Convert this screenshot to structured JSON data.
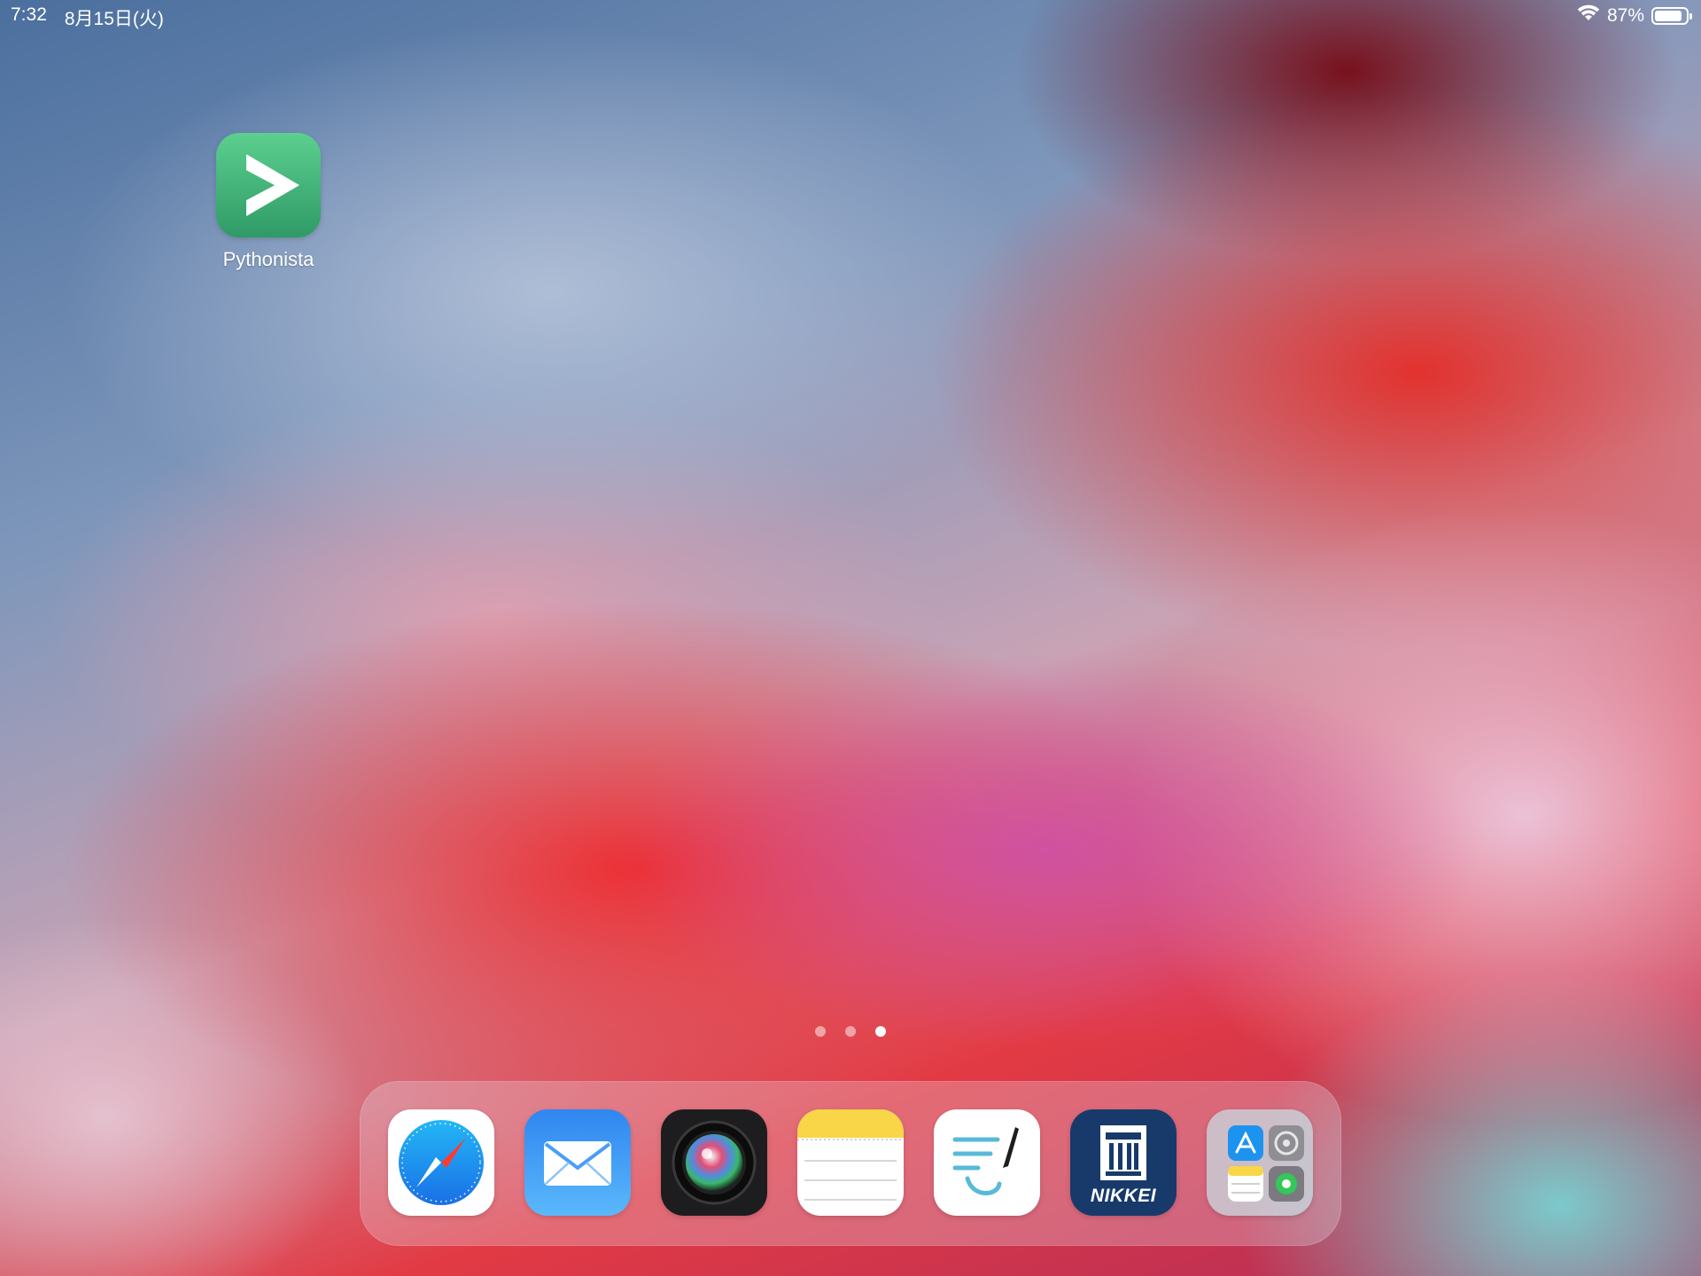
{
  "status_bar": {
    "time": "7:32",
    "date": "8月15日(火)",
    "battery_percent": "87%",
    "battery_level": 0.87,
    "icons": [
      "wifi-icon",
      "battery-icon"
    ]
  },
  "home_screen": {
    "apps": [
      {
        "label": "Pythonista",
        "icon": "pythonista-icon"
      }
    ],
    "page_dots": {
      "count": 3,
      "active_index": 2
    }
  },
  "dock": {
    "apps": [
      {
        "icon": "safari-icon"
      },
      {
        "icon": "mail-icon"
      },
      {
        "icon": "camera-lens-app-icon"
      },
      {
        "icon": "notes-icon"
      },
      {
        "icon": "handwriting-app-icon"
      },
      {
        "icon": "nikkei-icon",
        "text": "NIKKEI"
      },
      {
        "icon": "recent-apps-folder-icon"
      }
    ]
  },
  "colors": {
    "pythonista": "#3fb87c",
    "safari_blue": "#1c8cf0",
    "mail_blue": "#3d8ef3",
    "notes_yellow": "#f9d548",
    "nikkei_navy": "#173a6b"
  }
}
